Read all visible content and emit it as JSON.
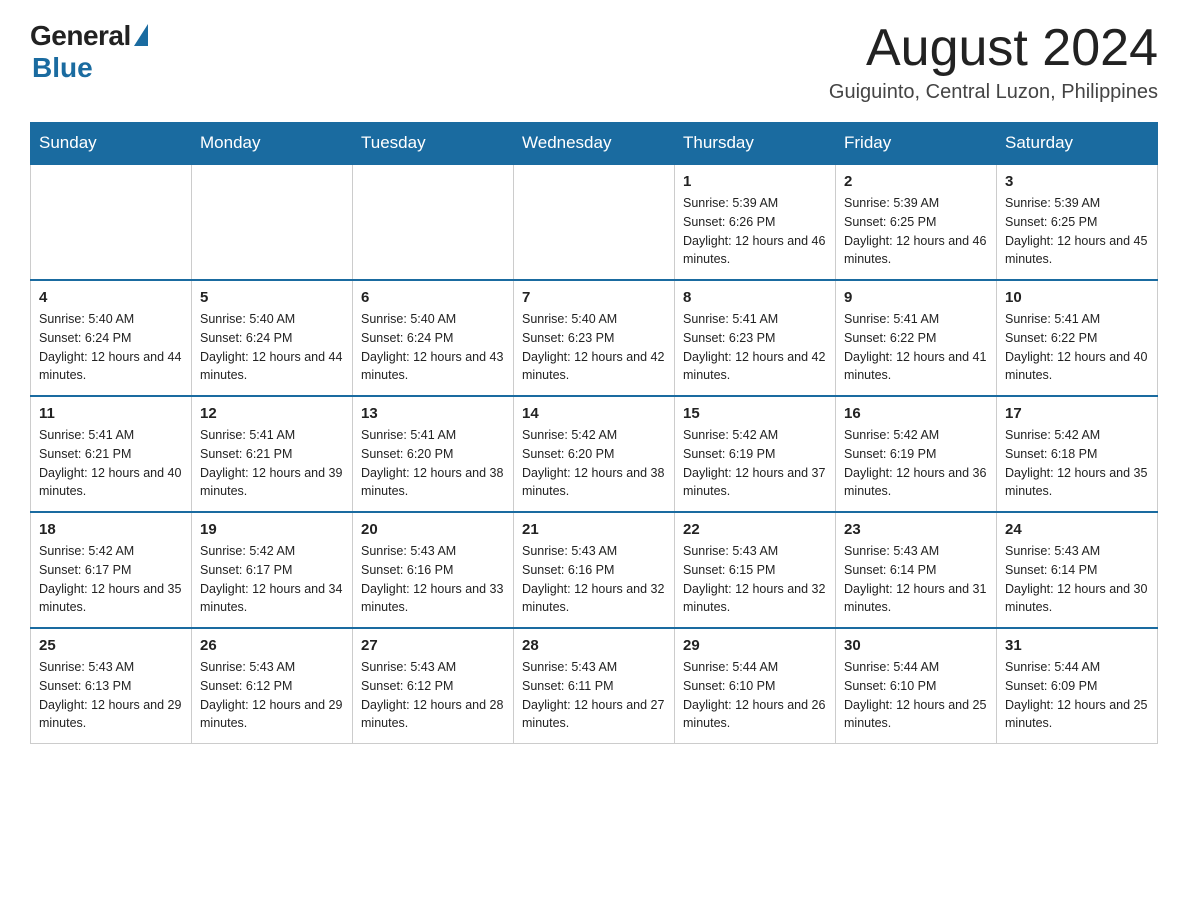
{
  "header": {
    "logo_general": "General",
    "logo_blue": "Blue",
    "month_year": "August 2024",
    "location": "Guiguinto, Central Luzon, Philippines"
  },
  "days_of_week": [
    "Sunday",
    "Monday",
    "Tuesday",
    "Wednesday",
    "Thursday",
    "Friday",
    "Saturday"
  ],
  "weeks": [
    {
      "days": [
        {
          "num": "",
          "sunrise": "",
          "sunset": "",
          "daylight": ""
        },
        {
          "num": "",
          "sunrise": "",
          "sunset": "",
          "daylight": ""
        },
        {
          "num": "",
          "sunrise": "",
          "sunset": "",
          "daylight": ""
        },
        {
          "num": "",
          "sunrise": "",
          "sunset": "",
          "daylight": ""
        },
        {
          "num": "1",
          "sunrise": "Sunrise: 5:39 AM",
          "sunset": "Sunset: 6:26 PM",
          "daylight": "Daylight: 12 hours and 46 minutes."
        },
        {
          "num": "2",
          "sunrise": "Sunrise: 5:39 AM",
          "sunset": "Sunset: 6:25 PM",
          "daylight": "Daylight: 12 hours and 46 minutes."
        },
        {
          "num": "3",
          "sunrise": "Sunrise: 5:39 AM",
          "sunset": "Sunset: 6:25 PM",
          "daylight": "Daylight: 12 hours and 45 minutes."
        }
      ]
    },
    {
      "days": [
        {
          "num": "4",
          "sunrise": "Sunrise: 5:40 AM",
          "sunset": "Sunset: 6:24 PM",
          "daylight": "Daylight: 12 hours and 44 minutes."
        },
        {
          "num": "5",
          "sunrise": "Sunrise: 5:40 AM",
          "sunset": "Sunset: 6:24 PM",
          "daylight": "Daylight: 12 hours and 44 minutes."
        },
        {
          "num": "6",
          "sunrise": "Sunrise: 5:40 AM",
          "sunset": "Sunset: 6:24 PM",
          "daylight": "Daylight: 12 hours and 43 minutes."
        },
        {
          "num": "7",
          "sunrise": "Sunrise: 5:40 AM",
          "sunset": "Sunset: 6:23 PM",
          "daylight": "Daylight: 12 hours and 42 minutes."
        },
        {
          "num": "8",
          "sunrise": "Sunrise: 5:41 AM",
          "sunset": "Sunset: 6:23 PM",
          "daylight": "Daylight: 12 hours and 42 minutes."
        },
        {
          "num": "9",
          "sunrise": "Sunrise: 5:41 AM",
          "sunset": "Sunset: 6:22 PM",
          "daylight": "Daylight: 12 hours and 41 minutes."
        },
        {
          "num": "10",
          "sunrise": "Sunrise: 5:41 AM",
          "sunset": "Sunset: 6:22 PM",
          "daylight": "Daylight: 12 hours and 40 minutes."
        }
      ]
    },
    {
      "days": [
        {
          "num": "11",
          "sunrise": "Sunrise: 5:41 AM",
          "sunset": "Sunset: 6:21 PM",
          "daylight": "Daylight: 12 hours and 40 minutes."
        },
        {
          "num": "12",
          "sunrise": "Sunrise: 5:41 AM",
          "sunset": "Sunset: 6:21 PM",
          "daylight": "Daylight: 12 hours and 39 minutes."
        },
        {
          "num": "13",
          "sunrise": "Sunrise: 5:41 AM",
          "sunset": "Sunset: 6:20 PM",
          "daylight": "Daylight: 12 hours and 38 minutes."
        },
        {
          "num": "14",
          "sunrise": "Sunrise: 5:42 AM",
          "sunset": "Sunset: 6:20 PM",
          "daylight": "Daylight: 12 hours and 38 minutes."
        },
        {
          "num": "15",
          "sunrise": "Sunrise: 5:42 AM",
          "sunset": "Sunset: 6:19 PM",
          "daylight": "Daylight: 12 hours and 37 minutes."
        },
        {
          "num": "16",
          "sunrise": "Sunrise: 5:42 AM",
          "sunset": "Sunset: 6:19 PM",
          "daylight": "Daylight: 12 hours and 36 minutes."
        },
        {
          "num": "17",
          "sunrise": "Sunrise: 5:42 AM",
          "sunset": "Sunset: 6:18 PM",
          "daylight": "Daylight: 12 hours and 35 minutes."
        }
      ]
    },
    {
      "days": [
        {
          "num": "18",
          "sunrise": "Sunrise: 5:42 AM",
          "sunset": "Sunset: 6:17 PM",
          "daylight": "Daylight: 12 hours and 35 minutes."
        },
        {
          "num": "19",
          "sunrise": "Sunrise: 5:42 AM",
          "sunset": "Sunset: 6:17 PM",
          "daylight": "Daylight: 12 hours and 34 minutes."
        },
        {
          "num": "20",
          "sunrise": "Sunrise: 5:43 AM",
          "sunset": "Sunset: 6:16 PM",
          "daylight": "Daylight: 12 hours and 33 minutes."
        },
        {
          "num": "21",
          "sunrise": "Sunrise: 5:43 AM",
          "sunset": "Sunset: 6:16 PM",
          "daylight": "Daylight: 12 hours and 32 minutes."
        },
        {
          "num": "22",
          "sunrise": "Sunrise: 5:43 AM",
          "sunset": "Sunset: 6:15 PM",
          "daylight": "Daylight: 12 hours and 32 minutes."
        },
        {
          "num": "23",
          "sunrise": "Sunrise: 5:43 AM",
          "sunset": "Sunset: 6:14 PM",
          "daylight": "Daylight: 12 hours and 31 minutes."
        },
        {
          "num": "24",
          "sunrise": "Sunrise: 5:43 AM",
          "sunset": "Sunset: 6:14 PM",
          "daylight": "Daylight: 12 hours and 30 minutes."
        }
      ]
    },
    {
      "days": [
        {
          "num": "25",
          "sunrise": "Sunrise: 5:43 AM",
          "sunset": "Sunset: 6:13 PM",
          "daylight": "Daylight: 12 hours and 29 minutes."
        },
        {
          "num": "26",
          "sunrise": "Sunrise: 5:43 AM",
          "sunset": "Sunset: 6:12 PM",
          "daylight": "Daylight: 12 hours and 29 minutes."
        },
        {
          "num": "27",
          "sunrise": "Sunrise: 5:43 AM",
          "sunset": "Sunset: 6:12 PM",
          "daylight": "Daylight: 12 hours and 28 minutes."
        },
        {
          "num": "28",
          "sunrise": "Sunrise: 5:43 AM",
          "sunset": "Sunset: 6:11 PM",
          "daylight": "Daylight: 12 hours and 27 minutes."
        },
        {
          "num": "29",
          "sunrise": "Sunrise: 5:44 AM",
          "sunset": "Sunset: 6:10 PM",
          "daylight": "Daylight: 12 hours and 26 minutes."
        },
        {
          "num": "30",
          "sunrise": "Sunrise: 5:44 AM",
          "sunset": "Sunset: 6:10 PM",
          "daylight": "Daylight: 12 hours and 25 minutes."
        },
        {
          "num": "31",
          "sunrise": "Sunrise: 5:44 AM",
          "sunset": "Sunset: 6:09 PM",
          "daylight": "Daylight: 12 hours and 25 minutes."
        }
      ]
    }
  ]
}
